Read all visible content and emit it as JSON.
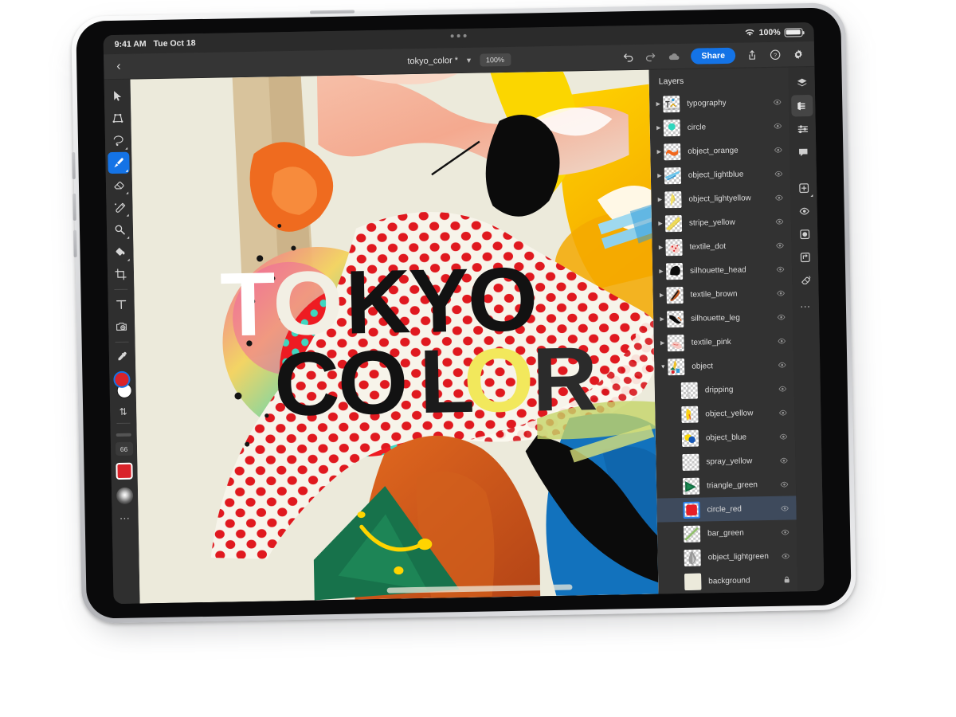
{
  "status_bar": {
    "time": "9:41 AM",
    "date": "Tue Oct 18",
    "battery_percent": "100%",
    "wifi_icon": "wifi-icon",
    "battery_icon": "battery-icon"
  },
  "toolbar": {
    "back_icon": "chevron-left-icon",
    "document_title": "tokyo_color *",
    "document_chevron": "chevron-down-icon",
    "zoom_level": "100%",
    "undo_icon": "undo-icon",
    "redo_icon": "redo-icon",
    "cloud_icon": "cloud-icon",
    "share_label": "Share",
    "export_icon": "export-icon",
    "help_icon": "help-circle-icon",
    "settings_icon": "gear-icon"
  },
  "left_tools": [
    {
      "name": "move-select-tool",
      "icon": "cursor-arrow-icon",
      "active": false,
      "has_submenu": false
    },
    {
      "name": "transform-tool",
      "icon": "transform-frame-icon",
      "active": false,
      "has_submenu": false
    },
    {
      "name": "lasso-tool",
      "icon": "lasso-icon",
      "active": false,
      "has_submenu": true
    },
    {
      "name": "brush-tool",
      "icon": "paintbrush-icon",
      "active": true,
      "has_submenu": true
    },
    {
      "name": "eraser-tool",
      "icon": "eraser-icon",
      "active": false,
      "has_submenu": true
    },
    {
      "name": "smudge-tool",
      "icon": "smudge-icon",
      "active": false,
      "has_submenu": true
    },
    {
      "name": "clone-stamp-tool",
      "icon": "magnifier-clone-icon",
      "active": false,
      "has_submenu": true
    },
    {
      "name": "paint-bucket-tool",
      "icon": "paint-bucket-icon",
      "active": false,
      "has_submenu": true
    },
    {
      "name": "crop-tool",
      "icon": "crop-icon",
      "active": false,
      "has_submenu": false
    },
    {
      "name": "type-tool",
      "icon": "text-t-icon",
      "active": false,
      "has_submenu": false
    },
    {
      "name": "place-image-tool",
      "icon": "add-photo-icon",
      "active": false,
      "has_submenu": false
    },
    {
      "name": "eyedropper-tool",
      "icon": "eyedropper-icon",
      "active": false,
      "has_submenu": false
    }
  ],
  "color_controls": {
    "foreground_color": "#d9232a",
    "background_color": "#ffffff",
    "swap_icon": "swap-arrows-icon",
    "brush_size": "66",
    "active_swatch_color": "#d9232a",
    "brush_preview_icon": "soft-round-brush-icon",
    "more_icon": "more-dots-icon"
  },
  "canvas": {
    "artwork_title_line1": "TOKYO",
    "artwork_title_line2": "COLOR"
  },
  "layers_panel": {
    "title": "Layers",
    "layers": [
      {
        "name": "typography",
        "child": false,
        "expandable": true,
        "expanded": false,
        "selected": false,
        "locked": false,
        "thumb": "typography"
      },
      {
        "name": "circle",
        "child": false,
        "expandable": true,
        "expanded": false,
        "selected": false,
        "locked": false,
        "thumb": "circle"
      },
      {
        "name": "object_orange",
        "child": false,
        "expandable": true,
        "expanded": false,
        "selected": false,
        "locked": false,
        "thumb": "object_orange"
      },
      {
        "name": "object_lightblue",
        "child": false,
        "expandable": true,
        "expanded": false,
        "selected": false,
        "locked": false,
        "thumb": "object_lightblue"
      },
      {
        "name": "object_lightyellow",
        "child": false,
        "expandable": true,
        "expanded": false,
        "selected": false,
        "locked": false,
        "thumb": "object_lightyellow"
      },
      {
        "name": "stripe_yellow",
        "child": false,
        "expandable": true,
        "expanded": false,
        "selected": false,
        "locked": false,
        "thumb": "stripe_yellow"
      },
      {
        "name": "textile_dot",
        "child": false,
        "expandable": true,
        "expanded": false,
        "selected": false,
        "locked": false,
        "thumb": "textile_dot"
      },
      {
        "name": "silhouette_head",
        "child": false,
        "expandable": true,
        "expanded": false,
        "selected": false,
        "locked": false,
        "thumb": "silhouette_head"
      },
      {
        "name": "textile_brown",
        "child": false,
        "expandable": true,
        "expanded": false,
        "selected": false,
        "locked": false,
        "thumb": "textile_brown"
      },
      {
        "name": "silhouette_leg",
        "child": false,
        "expandable": true,
        "expanded": false,
        "selected": false,
        "locked": false,
        "thumb": "silhouette_leg"
      },
      {
        "name": "textile_pink",
        "child": false,
        "expandable": true,
        "expanded": false,
        "selected": false,
        "locked": false,
        "thumb": "textile_pink"
      },
      {
        "name": "object",
        "child": false,
        "expandable": true,
        "expanded": true,
        "selected": false,
        "locked": false,
        "thumb": "object_group"
      },
      {
        "name": "dripping",
        "child": true,
        "expandable": false,
        "expanded": false,
        "selected": false,
        "locked": false,
        "thumb": "dripping"
      },
      {
        "name": "object_yellow",
        "child": true,
        "expandable": false,
        "expanded": false,
        "selected": false,
        "locked": false,
        "thumb": "object_yellow"
      },
      {
        "name": "object_blue",
        "child": true,
        "expandable": false,
        "expanded": false,
        "selected": false,
        "locked": false,
        "thumb": "object_blue"
      },
      {
        "name": "spray_yellow",
        "child": true,
        "expandable": false,
        "expanded": false,
        "selected": false,
        "locked": false,
        "thumb": "spray_yellow"
      },
      {
        "name": "triangle_green",
        "child": true,
        "expandable": false,
        "expanded": false,
        "selected": false,
        "locked": false,
        "thumb": "triangle_green"
      },
      {
        "name": "circle_red",
        "child": true,
        "expandable": false,
        "expanded": false,
        "selected": true,
        "locked": false,
        "thumb": "circle_red"
      },
      {
        "name": "bar_green",
        "child": true,
        "expandable": false,
        "expanded": false,
        "selected": false,
        "locked": false,
        "thumb": "bar_green"
      },
      {
        "name": "object_lightgreen",
        "child": true,
        "expandable": false,
        "expanded": false,
        "selected": false,
        "locked": false,
        "thumb": "object_lightgreen"
      },
      {
        "name": "background",
        "child": true,
        "expandable": false,
        "expanded": false,
        "selected": false,
        "locked": true,
        "thumb": "background"
      }
    ],
    "visibility_icon": "eye-icon",
    "lock_icon": "lock-icon"
  },
  "right_rail": [
    {
      "name": "layers-stack-button",
      "icon": "layers-stack-icon",
      "active": false,
      "has_submenu": false
    },
    {
      "name": "layer-properties-button",
      "icon": "layers-list-icon",
      "active": true,
      "has_submenu": false
    },
    {
      "name": "adjustments-button",
      "icon": "sliders-icon",
      "active": false,
      "has_submenu": false
    },
    {
      "name": "comments-button",
      "icon": "comment-bubble-icon",
      "active": false,
      "has_submenu": false
    },
    {
      "name": "add-layer-button",
      "icon": "add-square-icon",
      "active": false,
      "has_submenu": true
    },
    {
      "name": "layer-visibility-button",
      "icon": "eye-icon",
      "active": false,
      "has_submenu": false
    },
    {
      "name": "layer-mask-button",
      "icon": "mask-circle-icon",
      "active": false,
      "has_submenu": false
    },
    {
      "name": "clipping-mask-button",
      "icon": "clipping-mask-icon",
      "active": false,
      "has_submenu": false
    },
    {
      "name": "blend-mode-button",
      "icon": "blend-eraser-icon",
      "active": false,
      "has_submenu": false
    }
  ],
  "right_rail_more_icon": "more-dots-icon"
}
